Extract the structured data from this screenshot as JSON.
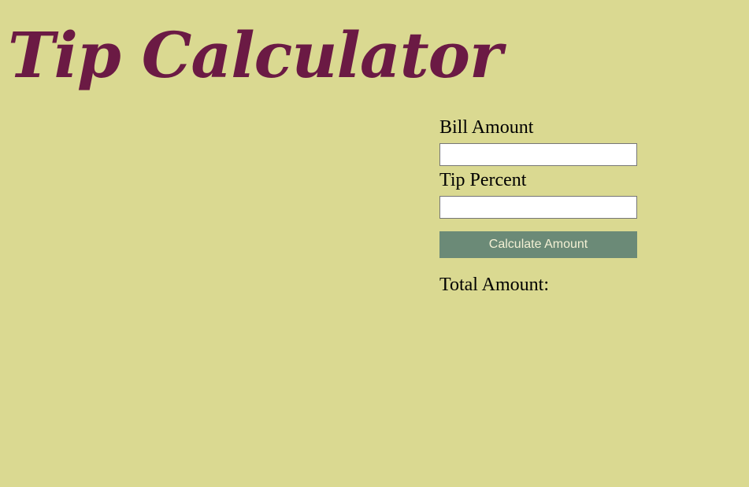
{
  "header": {
    "title": "Tip Calculator"
  },
  "form": {
    "bill_label": "Bill Amount",
    "bill_value": "",
    "tip_label": "Tip Percent",
    "tip_value": "",
    "calculate_label": "Calculate Amount",
    "total_label": "Total Amount:",
    "total_value": ""
  },
  "colors": {
    "background": "#dad991",
    "title": "#6b1a44",
    "button_bg": "#6b8a77",
    "button_text": "#f3f0d4"
  }
}
